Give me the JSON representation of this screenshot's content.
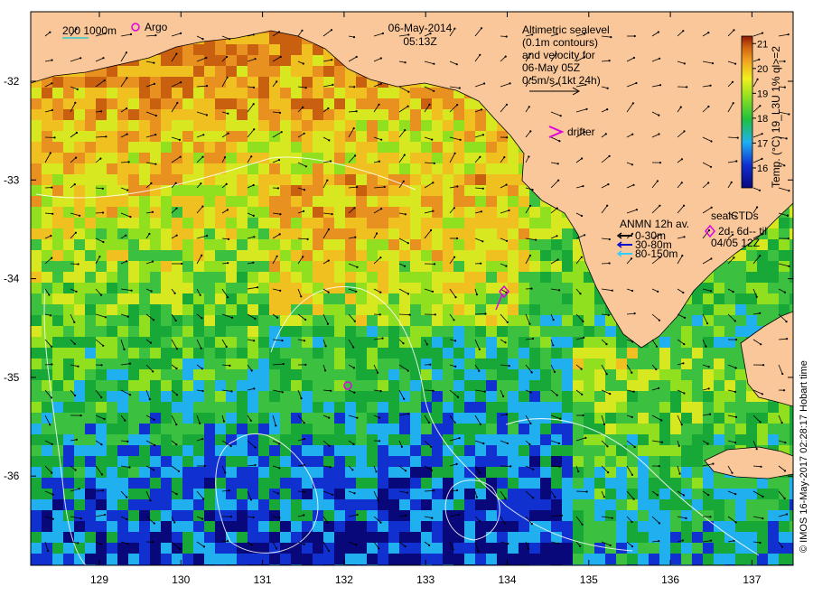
{
  "title": {
    "date": "06-May-2014",
    "time": "05:13Z"
  },
  "legend_topleft": {
    "isobaths": "200  1000m",
    "argo": "Argo"
  },
  "altimetry_note": [
    "Altimetric sealevel",
    "(0.1m contours)",
    "and velocity for",
    "06-May 05Z",
    "0.5m/s (1kt 24h)"
  ],
  "drifter_label": "drifter",
  "anmn": {
    "title": "ANMN 12h av.",
    "items": [
      {
        "label": "0-30m",
        "color": "#000000"
      },
      {
        "label": "30-80m",
        "color": "#0000cc"
      },
      {
        "label": "80-150m",
        "color": "#33ccff"
      }
    ]
  },
  "sealctds": {
    "title": "sealCTDs",
    "line1": "2d- 6d-- til",
    "line2": "04/05 12Z"
  },
  "colorbar": {
    "label": "Temp. (°C) 19_L3U 1% ql>=2",
    "ticks": [
      "21",
      "20",
      "19",
      "18",
      "17",
      "16"
    ],
    "range": [
      15.2,
      21.3
    ]
  },
  "x_ticks": [
    "129",
    "130",
    "131",
    "132",
    "133",
    "134",
    "135",
    "136",
    "137"
  ],
  "y_ticks": [
    "-32",
    "-33",
    "-34",
    "-35",
    "-36"
  ],
  "credit": "© IMOS 16-May-2017 02:28:17 Hobart time",
  "colors": {
    "land": "#f9c79a",
    "contour": "#ffffff",
    "marker": "#e000e0"
  }
}
